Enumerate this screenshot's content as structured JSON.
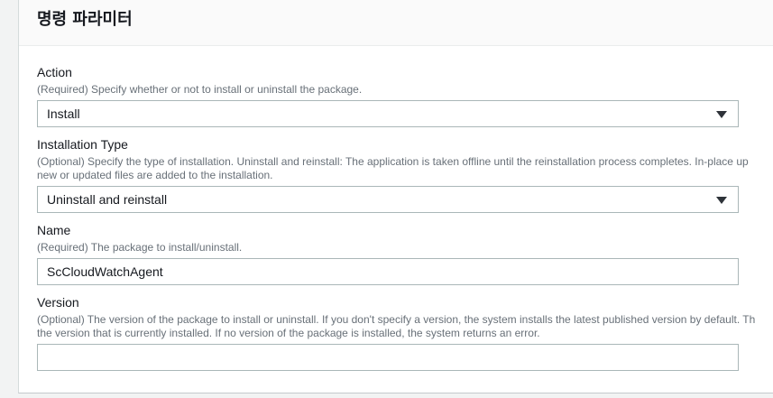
{
  "panel": {
    "title": "명령 파라미터"
  },
  "fields": {
    "action": {
      "label": "Action",
      "description": "(Required) Specify whether or not to install or uninstall the package.",
      "value": "Install"
    },
    "installation_type": {
      "label": "Installation Type",
      "description_line1": "(Optional) Specify the type of installation. Uninstall and reinstall: The application is taken offline until the reinstallation process completes. In-place up",
      "description_line2": "new or updated files are added to the installation.",
      "value": "Uninstall and reinstall"
    },
    "name": {
      "label": "Name",
      "description": "(Required) The package to install/uninstall.",
      "value": "ScCloudWatchAgent"
    },
    "version": {
      "label": "Version",
      "description_line1": "(Optional) The version of the package to install or uninstall. If you don't specify a version, the system installs the latest published version by default. Th",
      "description_line2": "the version that is currently installed. If no version of the package is installed, the system returns an error.",
      "value": ""
    }
  },
  "icons": {
    "dropdown": "caret-down-icon"
  }
}
